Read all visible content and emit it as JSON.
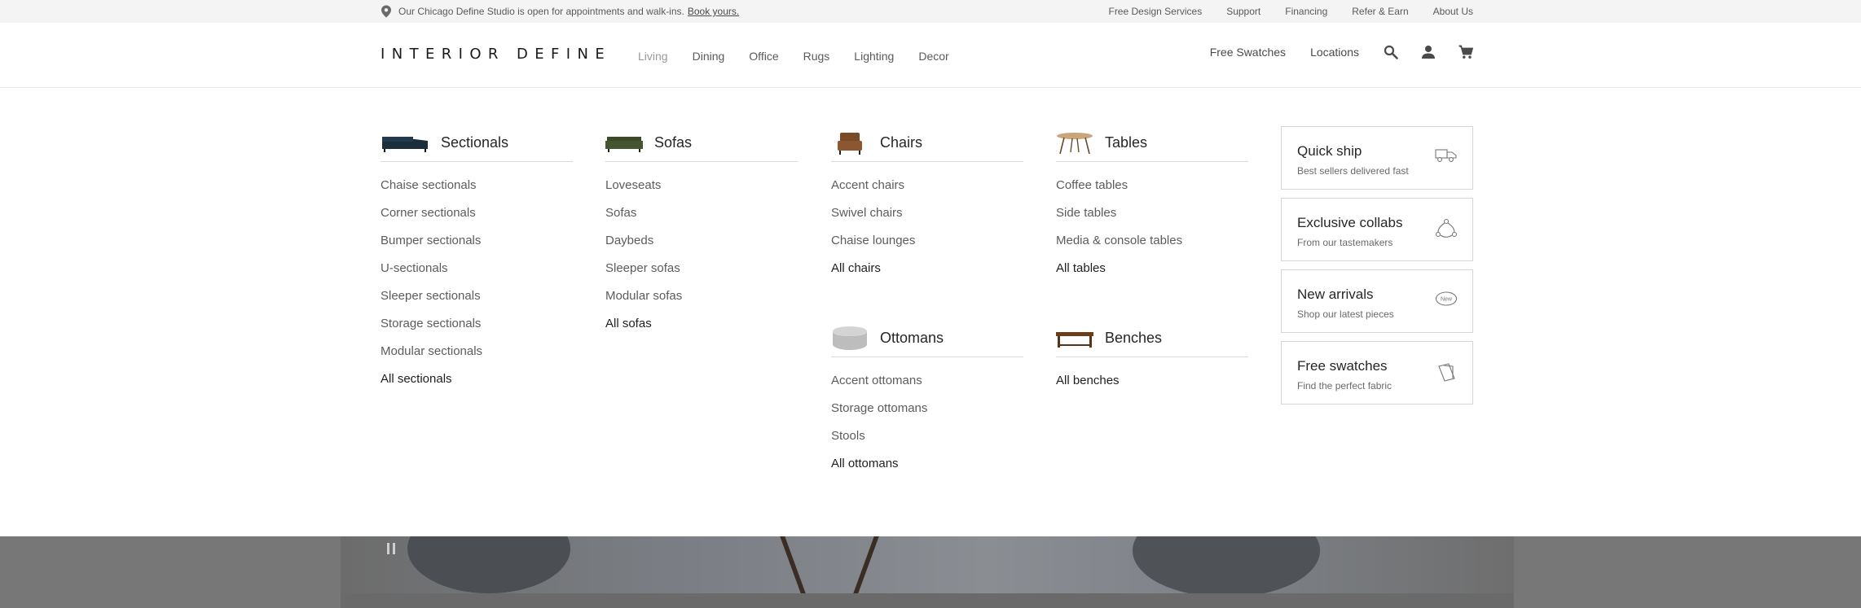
{
  "promo": {
    "location_text": "Our Chicago Define Studio is open for appointments and walk-ins.",
    "cta": "Book yours.",
    "links": [
      "Free Design Services",
      "Support",
      "Financing",
      "Refer & Earn",
      "About Us"
    ]
  },
  "header": {
    "logo": "INTERIOR DEFINE",
    "nav": [
      "Living",
      "Dining",
      "Office",
      "Rugs",
      "Lighting",
      "Decor"
    ],
    "active_nav": "Living",
    "util": {
      "swatches": "Free Swatches",
      "locations": "Locations"
    },
    "icons": [
      "search-icon",
      "account-icon",
      "cart-icon"
    ]
  },
  "menu": {
    "sectionals": {
      "title": "Sectionals",
      "items": [
        "Chaise sectionals",
        "Corner sectionals",
        "Bumper sectionals",
        "U-sectionals",
        "Sleeper sectionals",
        "Storage sectionals",
        "Modular sectionals"
      ],
      "all": "All sectionals"
    },
    "sofas": {
      "title": "Sofas",
      "items": [
        "Loveseats",
        "Sofas",
        "Daybeds",
        "Sleeper sofas",
        "Modular sofas"
      ],
      "all": "All sofas"
    },
    "chairs": {
      "title": "Chairs",
      "items": [
        "Accent chairs",
        "Swivel chairs",
        "Chaise lounges"
      ],
      "all": "All chairs"
    },
    "tables": {
      "title": "Tables",
      "items": [
        "Coffee tables",
        "Side tables",
        "Media & console tables"
      ],
      "all": "All tables"
    },
    "ottomans": {
      "title": "Ottomans",
      "items": [
        "Accent ottomans",
        "Storage ottomans",
        "Stools"
      ],
      "all": "All ottomans"
    },
    "benches": {
      "title": "Benches",
      "items": [],
      "all": "All benches"
    }
  },
  "cards": [
    {
      "title": "Quick ship",
      "subtitle": "Best sellers delivered fast",
      "icon": "truck-icon"
    },
    {
      "title": "Exclusive collabs",
      "subtitle": "From our tastemakers",
      "icon": "collab-icon"
    },
    {
      "title": "New arrivals",
      "subtitle": "Shop our latest pieces",
      "icon": "new-badge-icon",
      "badge": "New"
    },
    {
      "title": "Free swatches",
      "subtitle": "Find the perfect fabric",
      "icon": "swatch-icon"
    }
  ],
  "colors": {
    "promo_bg": "#f4f4f4",
    "text": "#2b2b2b",
    "muted": "#5c5c5c",
    "border": "#d9d9d9"
  }
}
